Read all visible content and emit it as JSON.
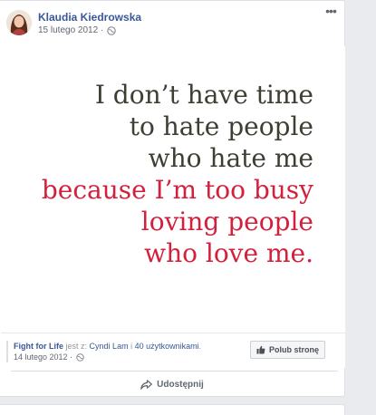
{
  "post": {
    "author": "Klaudia Kiedrowska",
    "date": "15 lutego 2012",
    "more_label": "•••"
  },
  "quote": {
    "lines_dark": [
      "I don’t have time",
      "to hate people",
      "who hate me"
    ],
    "lines_red": [
      "because I’m too busy",
      "loving people",
      "who love me."
    ],
    "colors": {
      "dark": "#3e3e32",
      "red": "#d3203c"
    }
  },
  "shared_from": {
    "page_name": "Fight for Life",
    "mid_text": "jest z:",
    "friend_name": "Cyndi Lam",
    "conjunction": "i",
    "others": "40 użytkownikami",
    "period": ".",
    "date": "14 lutego 2012 ·",
    "like_page_label": "Polub stronę"
  },
  "actions": {
    "share_label": "Udostępnij"
  },
  "icons": {
    "globe": "globe-icon",
    "more": "more-icon",
    "like": "thumbs-up-icon",
    "share": "share-arrow-icon"
  },
  "colors": {
    "link": "#385898",
    "background": "#e9ebee"
  }
}
